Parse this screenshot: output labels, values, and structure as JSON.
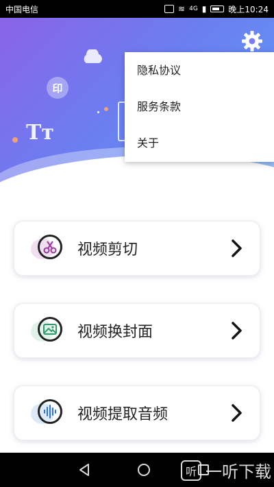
{
  "status_bar": {
    "carrier": "中国电信",
    "time": "晚上10:24",
    "network": "4G"
  },
  "header": {
    "deco_text_1": "Tт",
    "deco_text_2": "印"
  },
  "menu": {
    "items": [
      {
        "label": "隐私协议"
      },
      {
        "label": "服务条款"
      },
      {
        "label": "关于"
      }
    ]
  },
  "features": [
    {
      "label": "视频剪切",
      "icon": "scissors-icon",
      "accent": "#f1dff1"
    },
    {
      "label": "视频换封面",
      "icon": "image-icon",
      "accent": "#dff3e8"
    },
    {
      "label": "视频提取音频",
      "icon": "audio-wave-icon",
      "accent": "#dbe9f8"
    }
  ],
  "watermark": {
    "logo": "听",
    "text": "一听下载"
  },
  "colors": {
    "header_start": "#8a63e9",
    "header_end": "#5aa0f5",
    "scissors": "#9b3a9b",
    "image": "#2e9a6a",
    "audio": "#2f74c8"
  }
}
